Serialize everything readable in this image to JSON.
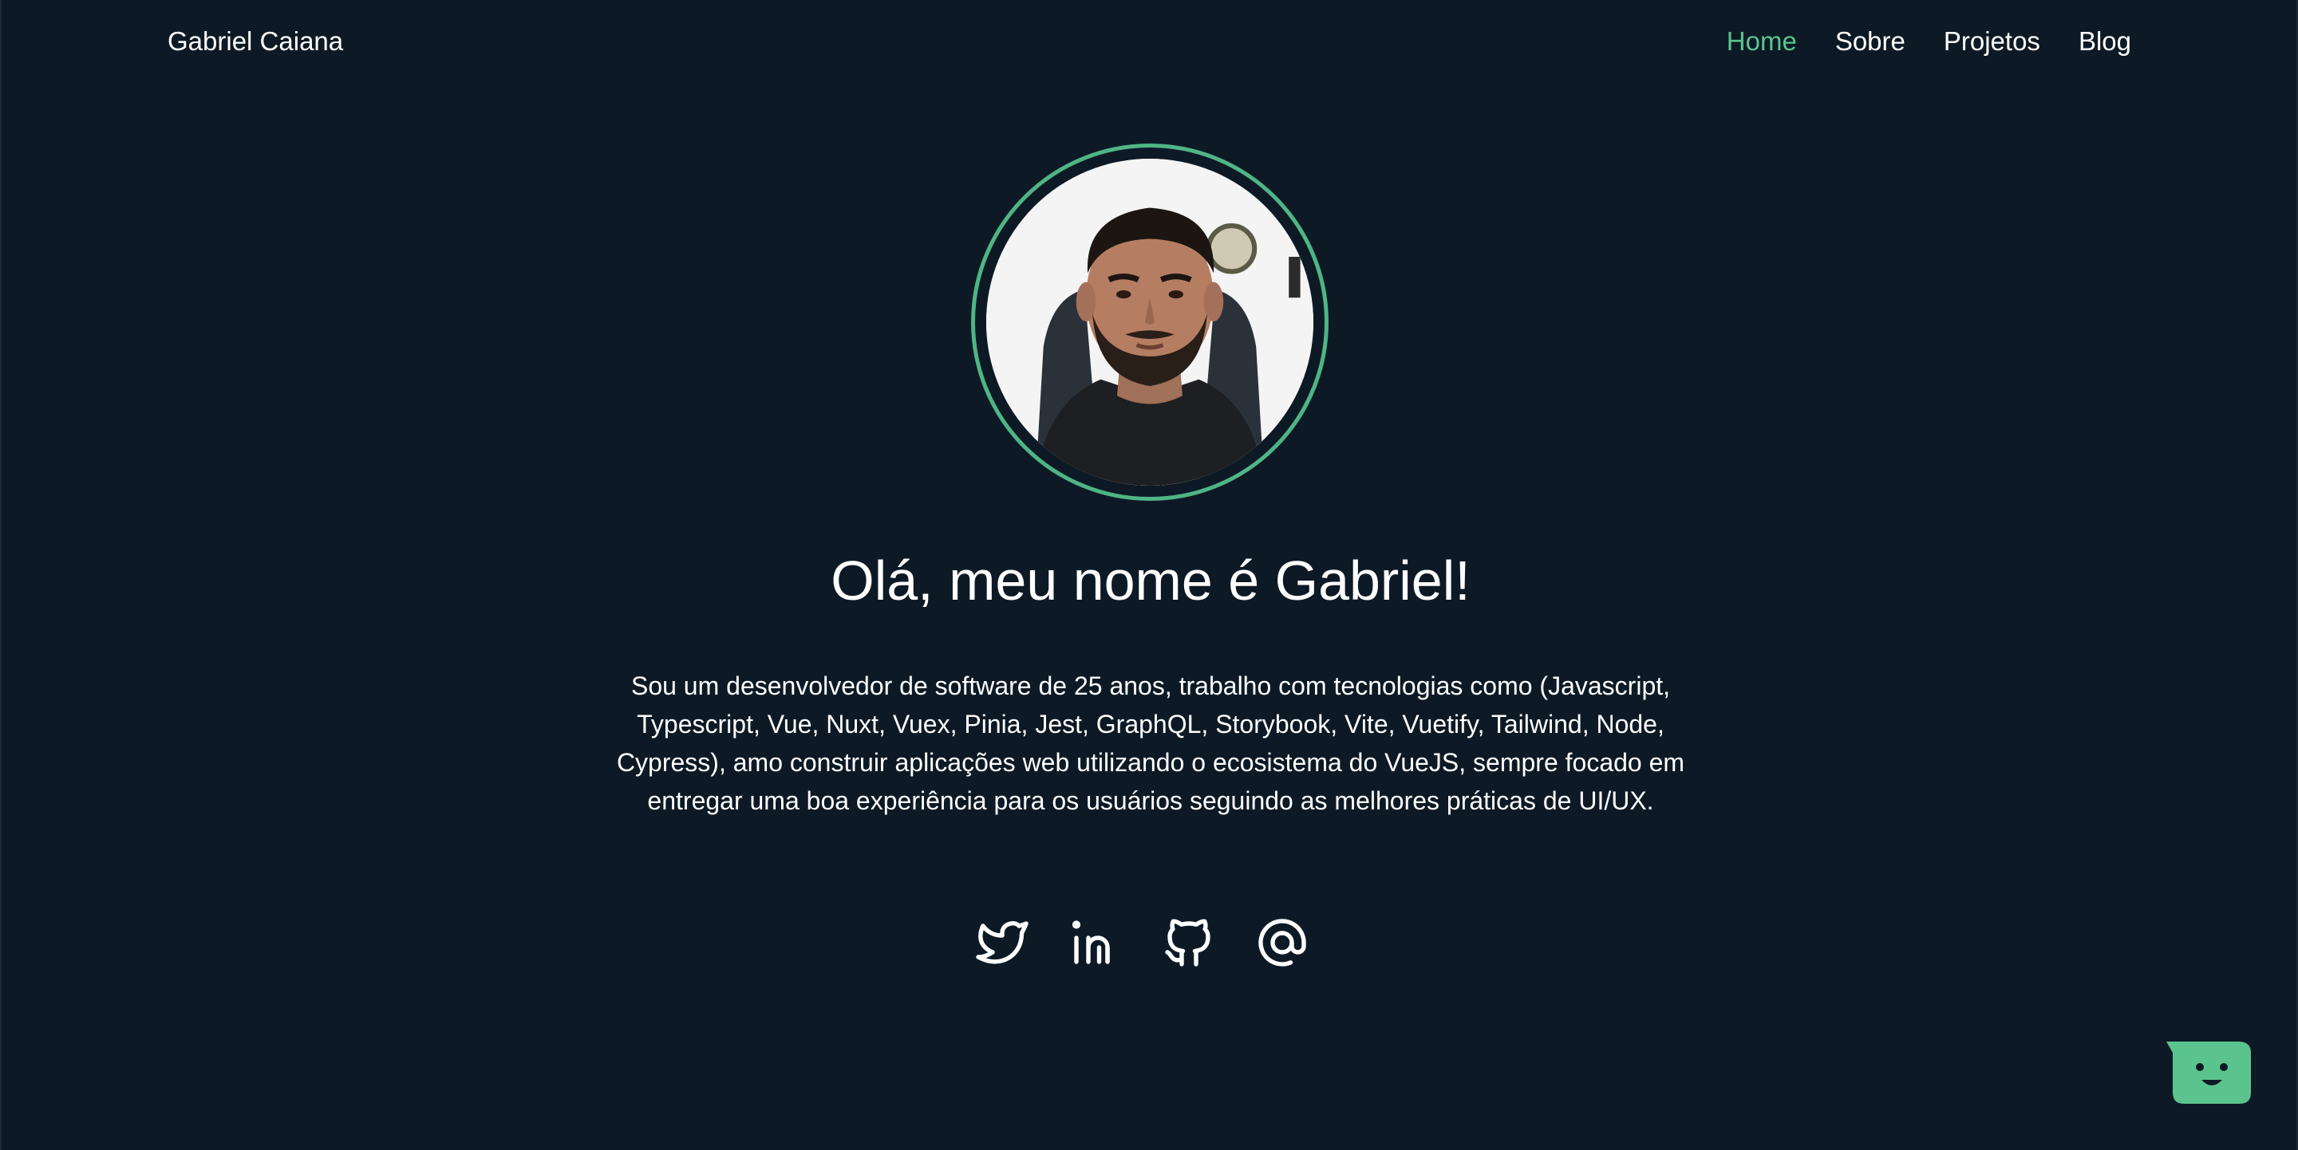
{
  "brand": "Gabriel Caiana",
  "nav": {
    "items": [
      {
        "label": "Home",
        "active": true
      },
      {
        "label": "Sobre",
        "active": false
      },
      {
        "label": "Projetos",
        "active": false
      },
      {
        "label": "Blog",
        "active": false
      }
    ]
  },
  "hero": {
    "headline": "Olá, meu nome é Gabriel!",
    "bio": "Sou um desenvolvedor de software de 25 anos, trabalho com tecnologias como (Javascript, Typescript, Vue, Nuxt, Vuex, Pinia, Jest, GraphQL, Storybook, Vite, Vuetify, Tailwind, Node, Cypress), amo construir aplicações web utilizando o ecosistema do VueJS, sempre focado em entregar uma boa experiência para os usuários seguindo as melhores práticas de UI/UX."
  },
  "socials": [
    {
      "icon": "twitter-icon"
    },
    {
      "icon": "linkedin-icon"
    },
    {
      "icon": "github-icon"
    },
    {
      "icon": "at-sign-icon"
    }
  ],
  "colors": {
    "background": "#0d1a26",
    "accent": "#5bc48e",
    "text": "#ffffff"
  }
}
